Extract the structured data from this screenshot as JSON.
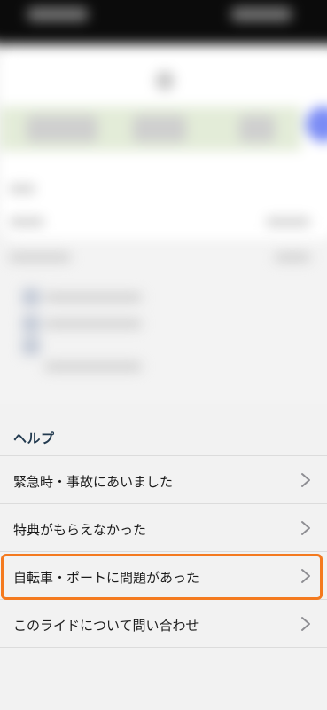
{
  "help": {
    "header": "ヘルプ",
    "items": [
      {
        "label": "緊急時・事故にあいました",
        "icon": "chevron-right-icon"
      },
      {
        "label": "特典がもらえなかった",
        "icon": "chevron-right-icon"
      },
      {
        "label": "自転車・ポートに問題があった",
        "icon": "chevron-right-icon",
        "highlighted": true
      },
      {
        "label": "このライドについて問い合わせ",
        "icon": "chevron-right-icon"
      }
    ]
  },
  "colors": {
    "header_text": "#223a4f",
    "highlight": "#f47a1f",
    "chevron": "#8e8e93",
    "divider": "#dcdcdc",
    "background": "#f2f2f2"
  }
}
